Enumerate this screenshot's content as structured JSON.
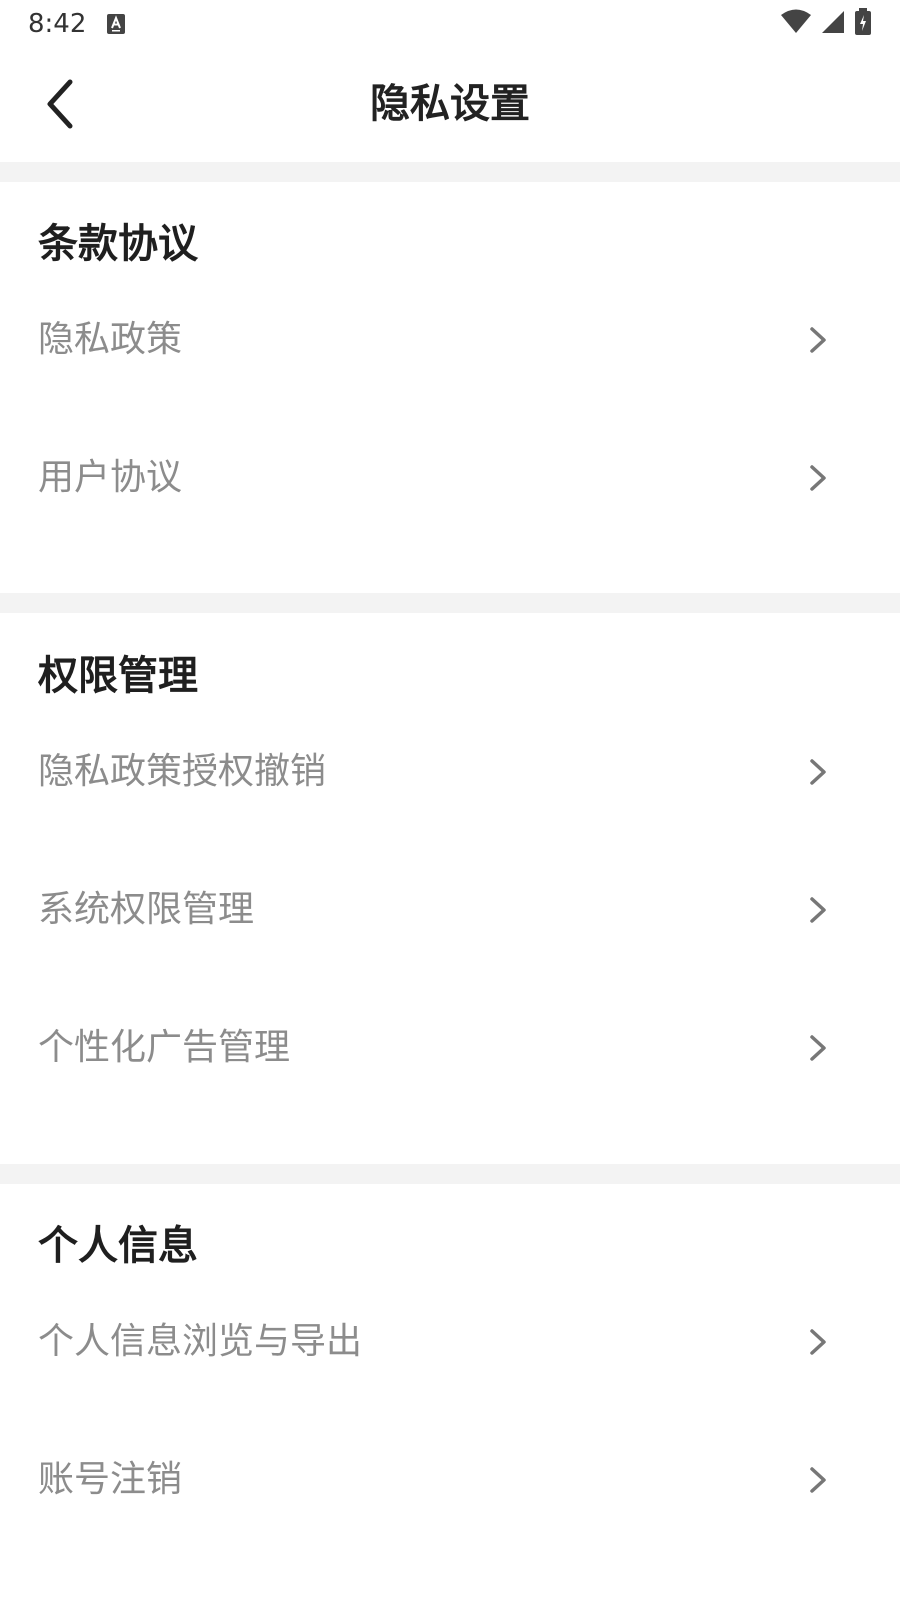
{
  "status_bar": {
    "time": "8:42",
    "notification_icon": "font-a-icon",
    "icons": [
      "wifi-icon",
      "signal-icon",
      "battery-icon"
    ]
  },
  "header": {
    "title": "隐私设置",
    "back_icon": "back-arrow-icon"
  },
  "sections": [
    {
      "title": "条款协议",
      "items": [
        "隐私政策",
        "用户协议"
      ]
    },
    {
      "title": "权限管理",
      "items": [
        "隐私政策授权撤销",
        "系统权限管理",
        "个性化广告管理"
      ]
    },
    {
      "title": "个人信息",
      "items": [
        "个人信息浏览与导出",
        "账号注销"
      ]
    }
  ],
  "colors": {
    "title": "#222222",
    "item_text": "#8c8c8c",
    "divider": "#f3f3f3",
    "chevron": "#777777"
  }
}
